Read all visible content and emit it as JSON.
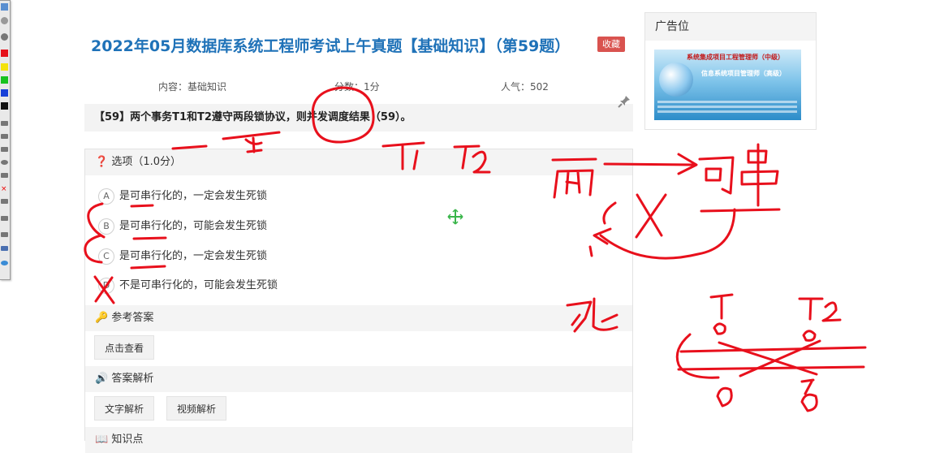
{
  "question": {
    "title": "2022年05月数据库系统工程师考试上午真题【基础知识】（第59题）",
    "favorite_label": "收藏",
    "meta": {
      "content": "内容：基础知识",
      "score": "分数：1分",
      "popularity": "人气：502"
    },
    "stem": "【59】两个事务T1和T2遵守两段锁协议，则并发调度结果（59）。"
  },
  "options_section": {
    "heading": "选项（1.0分）",
    "options": [
      {
        "letter": "A",
        "text": "是可串行化的，一定会发生死锁"
      },
      {
        "letter": "B",
        "text": "是可串行化的，可能会发生死锁"
      },
      {
        "letter": "C",
        "text": "是可串行化的，一定会发生死锁"
      },
      {
        "letter": "D",
        "text": "不是可串行化的，可能会发生死锁"
      }
    ]
  },
  "reference_answer": {
    "heading": "参考答案",
    "button": "点击查看"
  },
  "analysis": {
    "heading": "答案解析",
    "text_button": "文字解析",
    "video_button": "视频解析"
  },
  "knowledge": {
    "heading": "知识点"
  },
  "sidebar": {
    "ad_heading": "广告位",
    "ad_line1": "系统集成项目工程管理师（中级）",
    "ad_line2": "信息系统项目管理师（高级）"
  },
  "colors": {
    "title": "#1f72b8",
    "favorite": "#d9534f",
    "ink": "#e8101c"
  },
  "icons": {
    "options": "question-circle-icon",
    "reference": "key-icon",
    "analysis": "speaker-icon",
    "knowledge": "book-icon",
    "pin": "pin-icon"
  }
}
